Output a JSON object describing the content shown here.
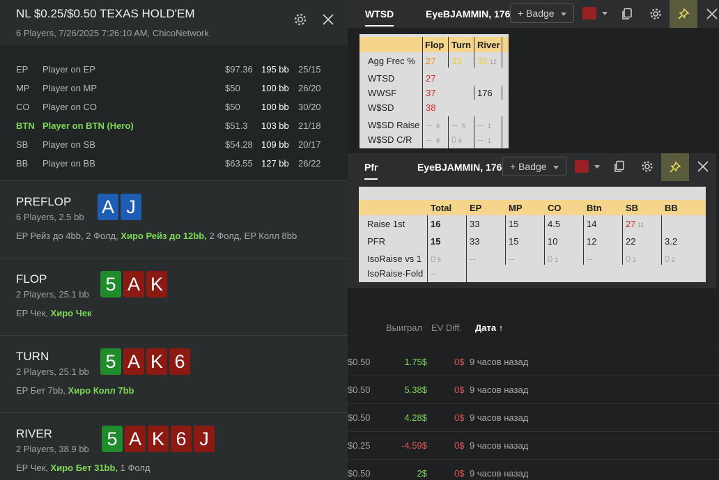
{
  "hand": {
    "title": "NL $0.25/$0.50 TEXAS HOLD'EM",
    "subtitle": "6 Players, 7/26/2025 7:26:10 AM, ChicoNetwork",
    "players": [
      {
        "pos": "EP",
        "name": "Player on EP",
        "stack": "$97.36",
        "bb": "195 bb",
        "stat": "25/15",
        "hero": false
      },
      {
        "pos": "MP",
        "name": "Player on MP",
        "stack": "$50",
        "bb": "100 bb",
        "stat": "26/20",
        "hero": false
      },
      {
        "pos": "CO",
        "name": "Player on CO",
        "stack": "$50",
        "bb": "100 bb",
        "stat": "30/20",
        "hero": false
      },
      {
        "pos": "BTN",
        "name": "Player on BTN (Hero)",
        "stack": "$51.3",
        "bb": "103 bb",
        "stat": "21/18",
        "hero": true
      },
      {
        "pos": "SB",
        "name": "Player on SB",
        "stack": "$54.28",
        "bb": "109 bb",
        "stat": "20/17",
        "hero": false
      },
      {
        "pos": "BB",
        "name": "Player on BB",
        "stack": "$63.55",
        "bb": "127 bb",
        "stat": "26/22",
        "hero": false
      }
    ],
    "streets": {
      "preflop": {
        "name": "PREFLOP",
        "sub": "6 Players, 2.5 bb",
        "cards": [
          "A",
          "J"
        ],
        "act1": "EP Рейз до 4bb, 2 Фолд, ",
        "act_hero": "Хиро Рейз до 12bb,",
        "act2": " 2 Фолд, EP Колл 8bb"
      },
      "flop": {
        "name": "FLOP",
        "sub": "2 Players, 25.1 bb",
        "cards": [
          "5",
          "A",
          "K"
        ],
        "act1": "EP Чек, ",
        "act_hero": "Хиро Чек",
        "act2": ""
      },
      "turn": {
        "name": "TURN",
        "sub": "2 Players, 25.1 bb",
        "cards": [
          "5",
          "A",
          "K",
          "6"
        ],
        "act1": "EP Бет 7bb, ",
        "act_hero": "Хиро Колл 7bb",
        "act2": ""
      },
      "river": {
        "name": "RIVER",
        "sub": "2 Players, 38.9 bb",
        "cards": [
          "5",
          "A",
          "K",
          "6",
          "J"
        ],
        "act1": "EP Чек, ",
        "act_hero": "Хиро Бет 31bb,",
        "act2": " 1 Фолд"
      }
    }
  },
  "hud1": {
    "tab": "WTSD",
    "player": "EyeBJAMMIN, 176",
    "badge": "+ Badge",
    "color": "#9a2024",
    "cols": [
      "Flop",
      "Turn",
      "River"
    ],
    "rows": [
      {
        "label": "Agg Frec %",
        "flop": "27",
        "turn": "33",
        "river": "33",
        "river_n": "12"
      },
      {
        "label": "WTSD",
        "flop": "27",
        "turn": "",
        "river": ""
      },
      {
        "label": "WWSF",
        "flop": "37",
        "turn": "",
        "river": "176"
      },
      {
        "label": "W$SD",
        "flop": "38",
        "turn": "",
        "river": ""
      },
      {
        "label": "W$SD Raise",
        "flop": "--",
        "flop_n": "8",
        "turn": "--",
        "turn_n": "5",
        "river": "--",
        "river_n": "1"
      },
      {
        "label": "W$SD C/R",
        "flop": "--",
        "flop_n": "8",
        "turn": "0",
        "turn_n": "5",
        "river": "--",
        "river_n": "1"
      }
    ]
  },
  "hud2": {
    "tab": "Pfr",
    "player": "EyeBJAMMIN, 176",
    "badge": "+ Badge",
    "color": "#9a2024",
    "cols": [
      "Total",
      "EP",
      "MP",
      "CO",
      "Btn",
      "SB",
      "BB"
    ],
    "rows": [
      {
        "label": "Raise 1st",
        "vals": [
          "16",
          "33",
          "15",
          "4.5",
          "14",
          "27",
          ""
        ],
        "extra": "11"
      },
      {
        "label": "PFR",
        "vals": [
          "15",
          "33",
          "15",
          "10",
          "12",
          "22",
          "3.2"
        ]
      },
      {
        "label": "IsoRaise vs 1",
        "vals": [
          "0",
          "--",
          "--",
          "0",
          "--",
          "0",
          "0"
        ],
        "ns": [
          "5",
          "",
          "",
          "1",
          "",
          "2",
          "2"
        ]
      },
      {
        "label": "IsoRaise-Fold",
        "vals": [
          "--",
          "",
          "",
          "",
          "",
          "",
          ""
        ]
      }
    ]
  },
  "list": {
    "headers": {
      "won": "Выиграл",
      "ev": "EV Diff.",
      "date": "Дата ↑"
    },
    "rows": [
      {
        "stake": "$0.50",
        "won": "1.75$",
        "ev": "0$",
        "time": "9 часов назад",
        "neg": false
      },
      {
        "stake": "$0.50",
        "won": "5.38$",
        "ev": "0$",
        "time": "9 часов назад",
        "neg": false
      },
      {
        "stake": "$0.50",
        "won": "4.28$",
        "ev": "0$",
        "time": "9 часов назад",
        "neg": false
      },
      {
        "stake": "$0.25",
        "won": "-4.59$",
        "ev": "0$",
        "time": "9 часов назад",
        "neg": true
      },
      {
        "stake": "$0.50",
        "won": "2$",
        "ev": "0$",
        "time": "9 часов назад",
        "neg": false
      }
    ]
  }
}
